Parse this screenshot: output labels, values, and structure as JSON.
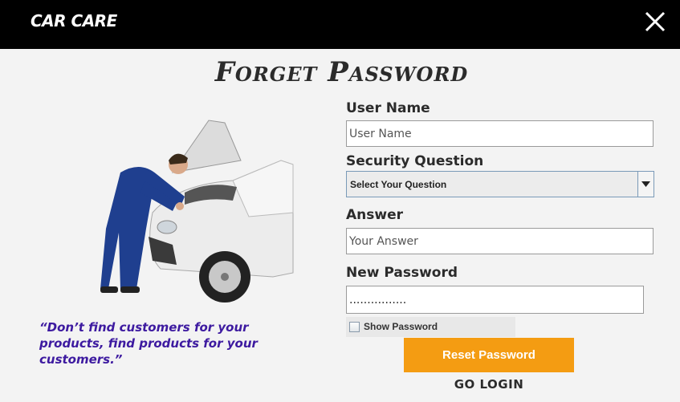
{
  "header": {
    "brand": "CAR CARE",
    "close_icon": "close-icon"
  },
  "title": "Forget Password",
  "illustration": {
    "icon": "mechanic-car-illustration"
  },
  "quote": "“Don’t find customers for your products, find products for your customers.”",
  "form": {
    "username": {
      "label": "User Name",
      "placeholder": "User Name"
    },
    "security_question": {
      "label": "Security Question",
      "selected": "Select Your Question",
      "icon": "chevron-down-icon"
    },
    "answer": {
      "label": "Answer",
      "placeholder": "Your Answer"
    },
    "new_password": {
      "label": "New Password",
      "value": "................"
    },
    "show_password": {
      "label": "Show Password",
      "checked": false
    },
    "reset_button": "Reset Password",
    "go_login": "GO LOGIN"
  }
}
